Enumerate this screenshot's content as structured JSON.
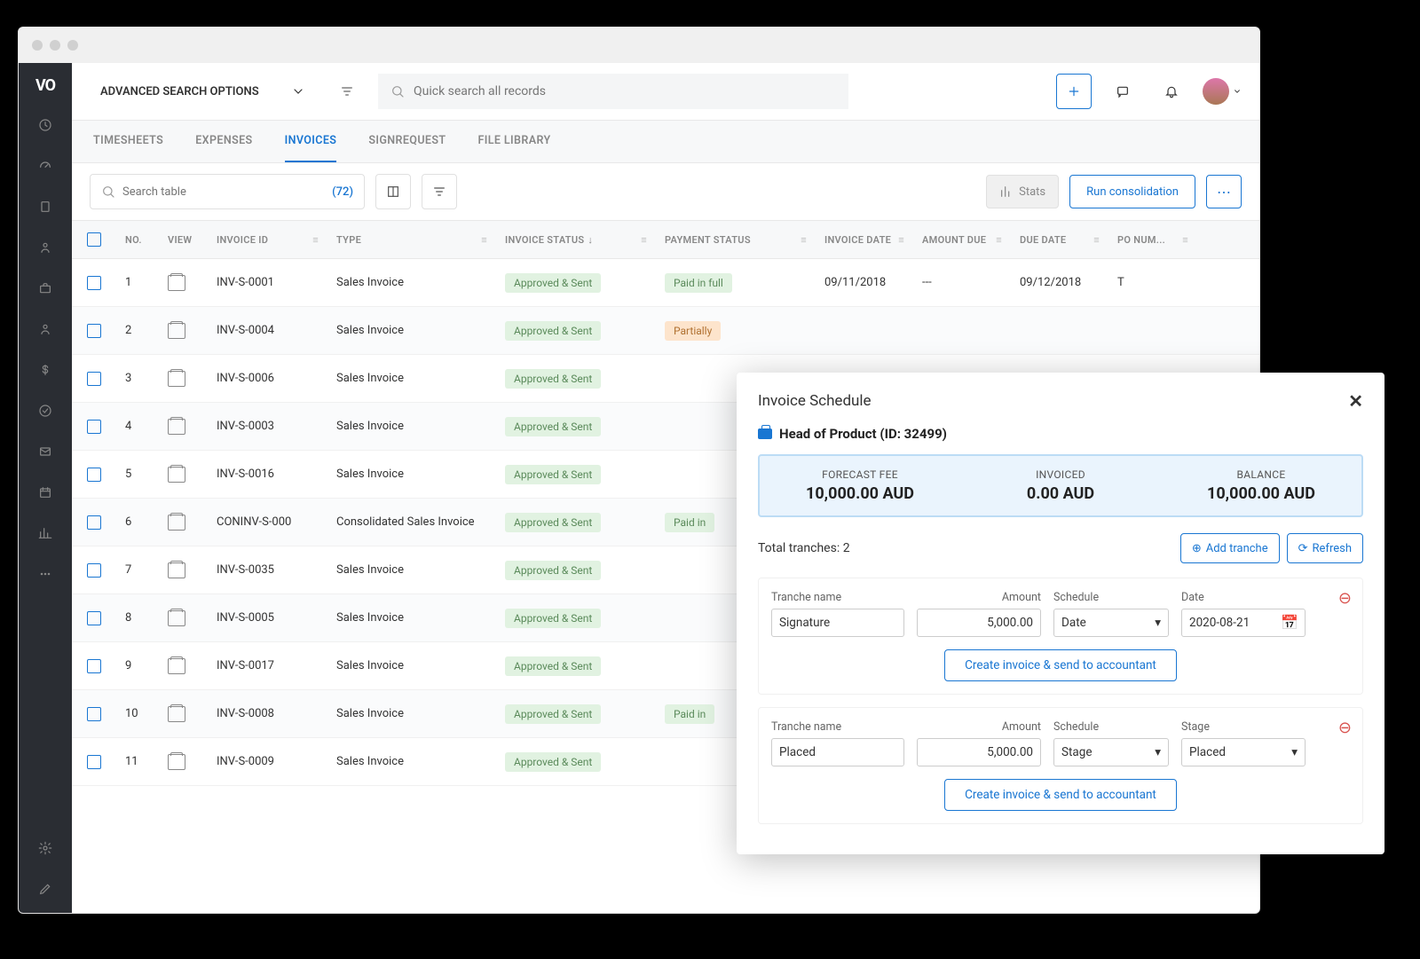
{
  "header": {
    "adv_search": "ADVANCED SEARCH OPTIONS",
    "quicksearch_placeholder": "Quick search all records"
  },
  "tabs": [
    "TIMESHEETS",
    "EXPENSES",
    "INVOICES",
    "SIGNREQUEST",
    "FILE LIBRARY"
  ],
  "active_tab": 2,
  "toolbar": {
    "search_placeholder": "Search table",
    "count": "(72)",
    "stats": "Stats",
    "run": "Run consolidation"
  },
  "columns": [
    "NO.",
    "VIEW",
    "INVOICE ID",
    "TYPE",
    "INVOICE STATUS",
    "PAYMENT STATUS",
    "INVOICE DATE",
    "AMOUNT DUE",
    "DUE DATE",
    "PO NUM..."
  ],
  "rows": [
    {
      "no": "1",
      "id": "INV-S-0001",
      "type": "Sales Invoice",
      "status": "Approved & Sent",
      "pay": "Paid in full",
      "pay_style": "green",
      "date": "09/11/2018",
      "amt": "---",
      "due": "09/12/2018",
      "po": "T"
    },
    {
      "no": "2",
      "id": "INV-S-0004",
      "type": "Sales Invoice",
      "status": "Approved & Sent",
      "pay": "Partially",
      "pay_style": "orange",
      "date": "",
      "amt": "",
      "due": "",
      "po": ""
    },
    {
      "no": "3",
      "id": "INV-S-0006",
      "type": "Sales Invoice",
      "status": "Approved & Sent",
      "pay": "",
      "pay_style": "",
      "date": "",
      "amt": "",
      "due": "",
      "po": ""
    },
    {
      "no": "4",
      "id": "INV-S-0003",
      "type": "Sales Invoice",
      "status": "Approved & Sent",
      "pay": "",
      "pay_style": "",
      "date": "",
      "amt": "",
      "due": "",
      "po": ""
    },
    {
      "no": "5",
      "id": "INV-S-0016",
      "type": "Sales Invoice",
      "status": "Approved & Sent",
      "pay": "",
      "pay_style": "",
      "date": "",
      "amt": "",
      "due": "",
      "po": ""
    },
    {
      "no": "6",
      "id": "CONINV-S-000",
      "type": "Consolidated Sales Invoice",
      "status": "Approved & Sent",
      "pay": "Paid in",
      "pay_style": "green",
      "date": "",
      "amt": "",
      "due": "",
      "po": ""
    },
    {
      "no": "7",
      "id": "INV-S-0035",
      "type": "Sales Invoice",
      "status": "Approved & Sent",
      "pay": "",
      "pay_style": "",
      "date": "",
      "amt": "",
      "due": "",
      "po": ""
    },
    {
      "no": "8",
      "id": "INV-S-0005",
      "type": "Sales Invoice",
      "status": "Approved & Sent",
      "pay": "",
      "pay_style": "",
      "date": "",
      "amt": "",
      "due": "",
      "po": ""
    },
    {
      "no": "9",
      "id": "INV-S-0017",
      "type": "Sales Invoice",
      "status": "Approved & Sent",
      "pay": "",
      "pay_style": "",
      "date": "",
      "amt": "",
      "due": "",
      "po": ""
    },
    {
      "no": "10",
      "id": "INV-S-0008",
      "type": "Sales Invoice",
      "status": "Approved & Sent",
      "pay": "Paid in",
      "pay_style": "green",
      "date": "",
      "amt": "",
      "due": "",
      "po": ""
    },
    {
      "no": "11",
      "id": "INV-S-0009",
      "type": "Sales Invoice",
      "status": "Approved & Sent",
      "pay": "",
      "pay_style": "",
      "date": "",
      "amt": "",
      "due": "",
      "po": ""
    }
  ],
  "modal": {
    "title": "Invoice Schedule",
    "job": "Head of Product (ID: 32499)",
    "summary": [
      {
        "label": "FORECAST FEE",
        "value": "10,000.00 AUD"
      },
      {
        "label": "INVOICED",
        "value": "0.00 AUD"
      },
      {
        "label": "BALANCE",
        "value": "10,000.00 AUD"
      }
    ],
    "total_label": "Total tranches:",
    "total_count": "2",
    "add_tranche": "Add tranche",
    "refresh": "Refresh",
    "create_btn": "Create invoice & send to accountant",
    "field_labels": {
      "name": "Tranche name",
      "amount": "Amount",
      "schedule": "Schedule",
      "date": "Date",
      "stage": "Stage"
    },
    "tranches": [
      {
        "name": "Signature",
        "amount": "5,000.00",
        "schedule": "Date",
        "extra_label": "Date",
        "extra_value": "2020-08-21",
        "has_cal": true
      },
      {
        "name": "Placed",
        "amount": "5,000.00",
        "schedule": "Stage",
        "extra_label": "Stage",
        "extra_value": "Placed",
        "has_cal": false
      }
    ]
  }
}
